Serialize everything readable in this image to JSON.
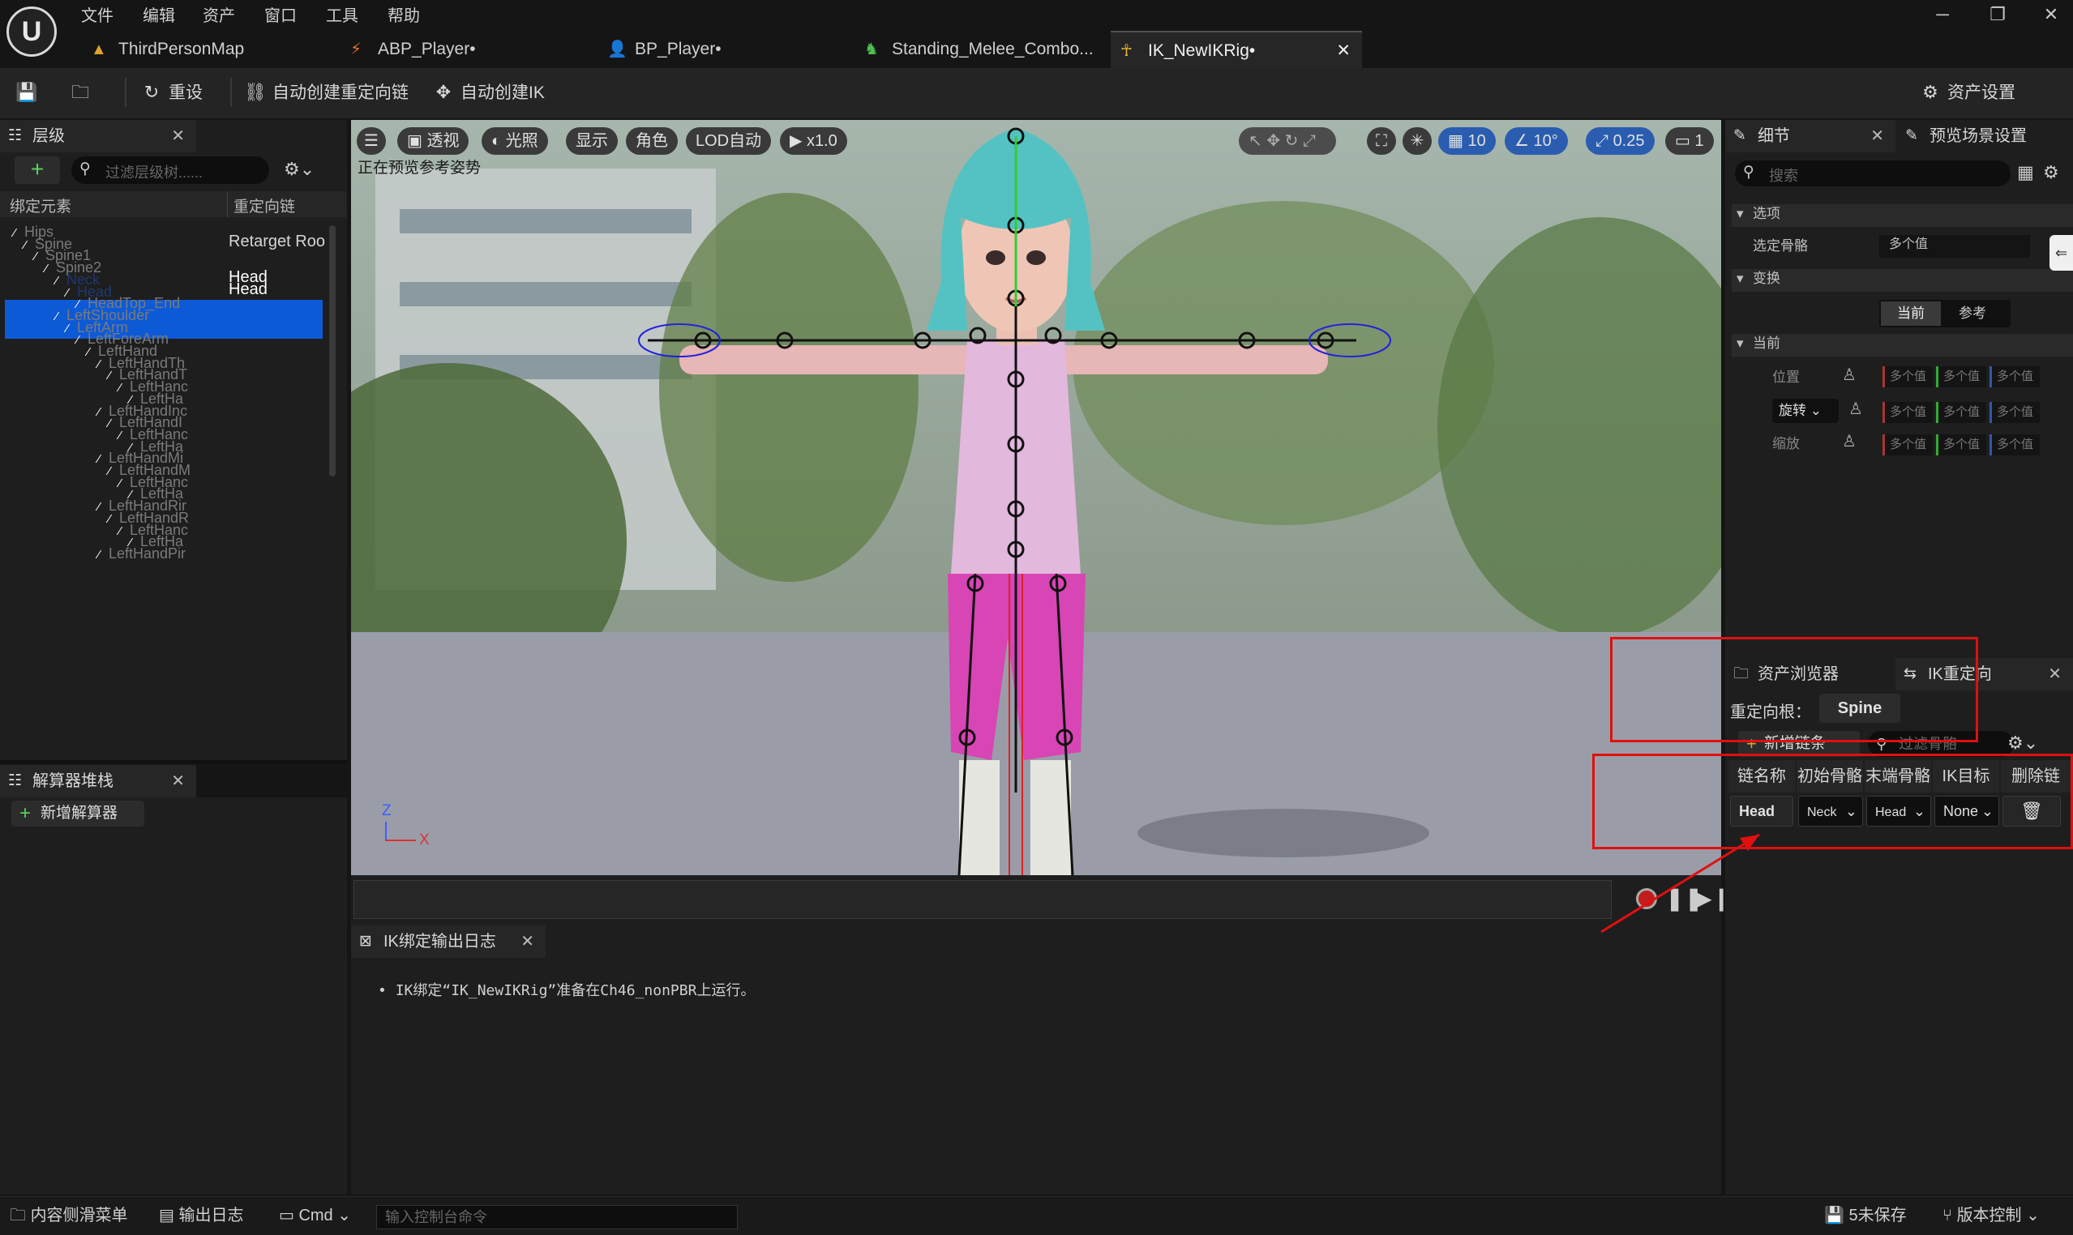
{
  "menu": [
    "文件",
    "编辑",
    "资产",
    "窗口",
    "工具",
    "帮助"
  ],
  "tabs": [
    {
      "label": "ThirdPersonMap",
      "icon": "map-icon"
    },
    {
      "label": "ABP_Player•",
      "icon": "anim-blueprint-icon"
    },
    {
      "label": "BP_Player•",
      "icon": "blueprint-icon"
    },
    {
      "label": "Standing_Melee_Combo...",
      "icon": "animation-icon"
    },
    {
      "label": "IK_NewIKRig•",
      "icon": "ik-rig-icon"
    }
  ],
  "toolbar": {
    "reset": "重设",
    "auto_chain": "自动创建重定向链",
    "auto_ik": "自动创建IK",
    "asset_settings": "资产设置"
  },
  "hierarchy": {
    "tab": "层级",
    "search_placeholder": "过滤层级树......",
    "col_element": "绑定元素",
    "col_chain": "重定向链",
    "rows": [
      {
        "name": "Hips",
        "chain": ""
      },
      {
        "name": "Spine",
        "chain": "Retarget Roo"
      },
      {
        "name": "Spine1",
        "chain": ""
      },
      {
        "name": "Spine2",
        "chain": ""
      },
      {
        "name": "Neck",
        "chain": "Head"
      },
      {
        "name": "Head",
        "chain": "Head"
      },
      {
        "name": "HeadTop_End",
        "chain": ""
      },
      {
        "name": "LeftShoulder",
        "chain": ""
      },
      {
        "name": "LeftArm",
        "chain": ""
      },
      {
        "name": "LeftForeArm",
        "chain": ""
      },
      {
        "name": "LeftHand",
        "chain": ""
      },
      {
        "name": "LeftHandTh",
        "chain": ""
      },
      {
        "name": "LeftHandT",
        "chain": ""
      },
      {
        "name": "LeftHanc",
        "chain": ""
      },
      {
        "name": "LeftHa",
        "chain": ""
      },
      {
        "name": "LeftHandInc",
        "chain": ""
      },
      {
        "name": "LeftHandI",
        "chain": ""
      },
      {
        "name": "LeftHanc",
        "chain": ""
      },
      {
        "name": "LeftHa",
        "chain": ""
      },
      {
        "name": "LeftHandMi",
        "chain": ""
      },
      {
        "name": "LeftHandM",
        "chain": ""
      },
      {
        "name": "LeftHanc",
        "chain": ""
      },
      {
        "name": "LeftHa",
        "chain": ""
      },
      {
        "name": "LeftHandRir",
        "chain": ""
      },
      {
        "name": "LeftHandR",
        "chain": ""
      },
      {
        "name": "LeftHanc",
        "chain": ""
      },
      {
        "name": "LeftHa",
        "chain": ""
      },
      {
        "name": "LeftHandPir",
        "chain": ""
      }
    ]
  },
  "solver": {
    "tab": "解算器堆栈",
    "add": "新增解算器"
  },
  "viewport": {
    "buttons": [
      "透视",
      "光照",
      "显示",
      "角色",
      "LOD自动",
      "x1.0"
    ],
    "right_values": [
      "10",
      "10°",
      "0.25",
      "1"
    ],
    "preview_text": "正在预览参考姿势",
    "axis_z": "Z",
    "axis_x": "X"
  },
  "log": {
    "tab": "IK绑定输出日志",
    "message": "IK绑定“IK_NewIKRig”准备在Ch46_nonPBR上运行。"
  },
  "details": {
    "tab": "细节",
    "tab2": "预览场景设置",
    "search_placeholder": "搜索",
    "section_options": "选项",
    "selected_bone_label": "选定骨骼",
    "selected_bone_value": "多个值",
    "section_transform": "变换",
    "btn_current": "当前",
    "btn_reference": "参考",
    "section_current": "当前",
    "position": "位置",
    "rotation": "旋转",
    "scale": "缩放",
    "multi": "多个值"
  },
  "ik_retarget": {
    "tab_browser": "资产浏览器",
    "tab": "IK重定向",
    "root_label": "重定向根：",
    "root_value": "Spine",
    "add_chain": "新增链条",
    "filter_placeholder": "过滤骨骼",
    "cols": [
      "链名称",
      "初始骨骼",
      "末端骨骼",
      "IK目标",
      "删除链"
    ],
    "chain": {
      "name": "Head",
      "start": "Neck",
      "end": "Head",
      "goal": "None"
    }
  },
  "statusbar": {
    "drawer": "内容侧滑菜单",
    "output": "输出日志",
    "cmd": "Cmd",
    "console_placeholder": "输入控制台命令",
    "unsaved": "5未保存",
    "source_control": "版本控制"
  }
}
